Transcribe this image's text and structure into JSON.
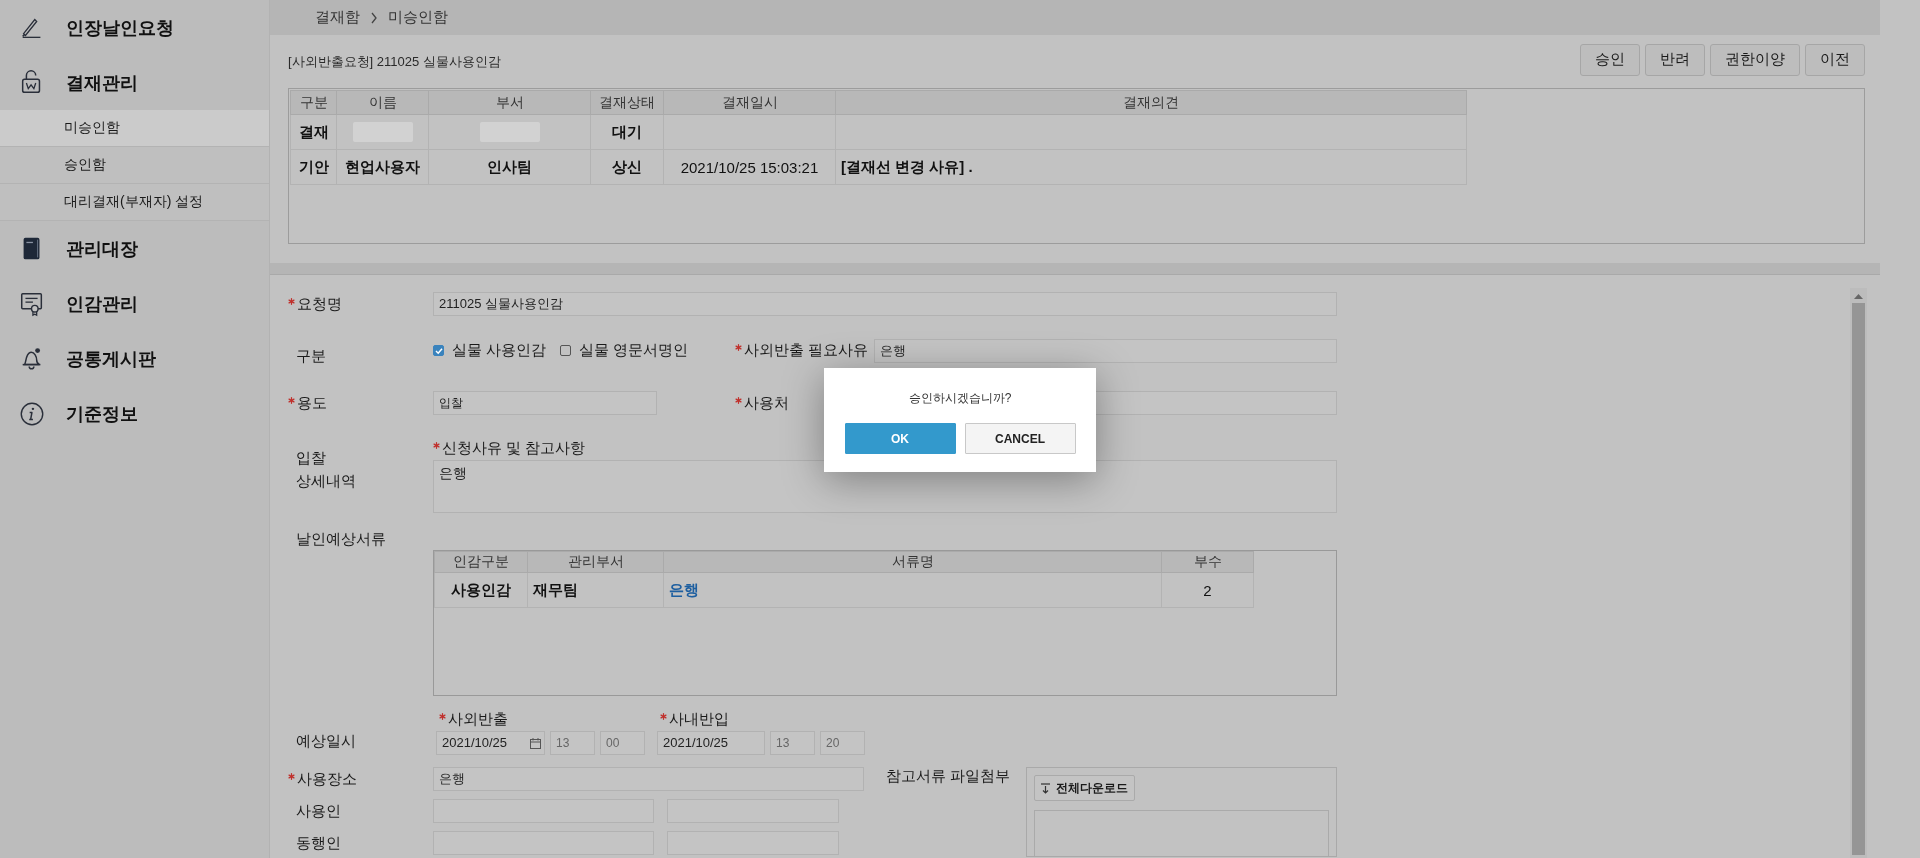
{
  "sidebar": {
    "items": [
      {
        "label": "인장날인요청"
      },
      {
        "label": "결재관리",
        "children": [
          {
            "label": "미승인함",
            "selected": true
          },
          {
            "label": "승인함",
            "selected": false
          },
          {
            "label": "대리결재(부재자) 설정",
            "selected": false
          }
        ]
      },
      {
        "label": "관리대장"
      },
      {
        "label": "인감관리"
      },
      {
        "label": "공통게시판"
      },
      {
        "label": "기준정보"
      }
    ]
  },
  "breadcrumb": [
    "결재함",
    "미승인함"
  ],
  "document": {
    "title": "[사외반출요청] 211025 실물사용인감",
    "actions": [
      "승인",
      "반려",
      "권한이양",
      "이전"
    ]
  },
  "approval_table": {
    "columns": [
      "구분",
      "이름",
      "부서",
      "결재상태",
      "결재일시",
      "결재의견"
    ],
    "rows": [
      {
        "division": "결재",
        "name_redacted": true,
        "dept_redacted": true,
        "status": "대기"
      },
      {
        "division": "기안",
        "name": "현업사용자",
        "dept": "인사팀",
        "status": "상신",
        "datetime": "2021/10/25 15:03:21",
        "comment": "[결재선 변경 사유] ."
      }
    ]
  },
  "form": {
    "request_name": {
      "label": "요청명",
      "required": true,
      "value": "211025 실물사용인감"
    },
    "category": {
      "label": "구분",
      "options": [
        {
          "label": "실물 사용인감",
          "checked": true
        },
        {
          "label": "실물 영문서명인",
          "checked": false
        }
      ]
    },
    "export_reason": {
      "label": "사외반출 필요사유",
      "required": true,
      "value": "은행"
    },
    "purpose": {
      "label": "용도",
      "required": true,
      "value": "입찰"
    },
    "use_place": {
      "label": "사용처",
      "required": true
    },
    "detail_label": [
      "입찰",
      "상세내역"
    ],
    "reason": {
      "label": "신청사유 및 참고사항",
      "required": true,
      "value": "은행"
    },
    "documents": {
      "label": "날인예상서류",
      "columns": [
        "인감구분",
        "관리부서",
        "서류명",
        "부수"
      ],
      "rows": [
        {
          "cells": [
            "사용인감",
            "재무팀",
            "은행",
            "2"
          ]
        }
      ]
    },
    "schedule": {
      "label": "예상일시",
      "groups": [
        {
          "label": "사외반출",
          "required": true,
          "date": "2021/10/25",
          "has_picker": true,
          "hour": "13",
          "minute": "00"
        },
        {
          "label": "사내반입",
          "required": true,
          "date": "2021/10/25",
          "has_picker": false,
          "hour": "13",
          "minute": "20"
        }
      ]
    },
    "place": {
      "label": "사용장소",
      "required": true,
      "value": "은행"
    },
    "user": {
      "label": "사용인"
    },
    "companion": {
      "label": "동행인"
    },
    "attachments": {
      "label": "참고서류 파일첨부",
      "download_button": "전체다운로드"
    }
  },
  "dialog": {
    "message": "승인하시겠습니까?",
    "buttons": [
      {
        "label": "OK",
        "kind": "primary"
      },
      {
        "label": "CANCEL",
        "kind": "secondary"
      }
    ]
  }
}
